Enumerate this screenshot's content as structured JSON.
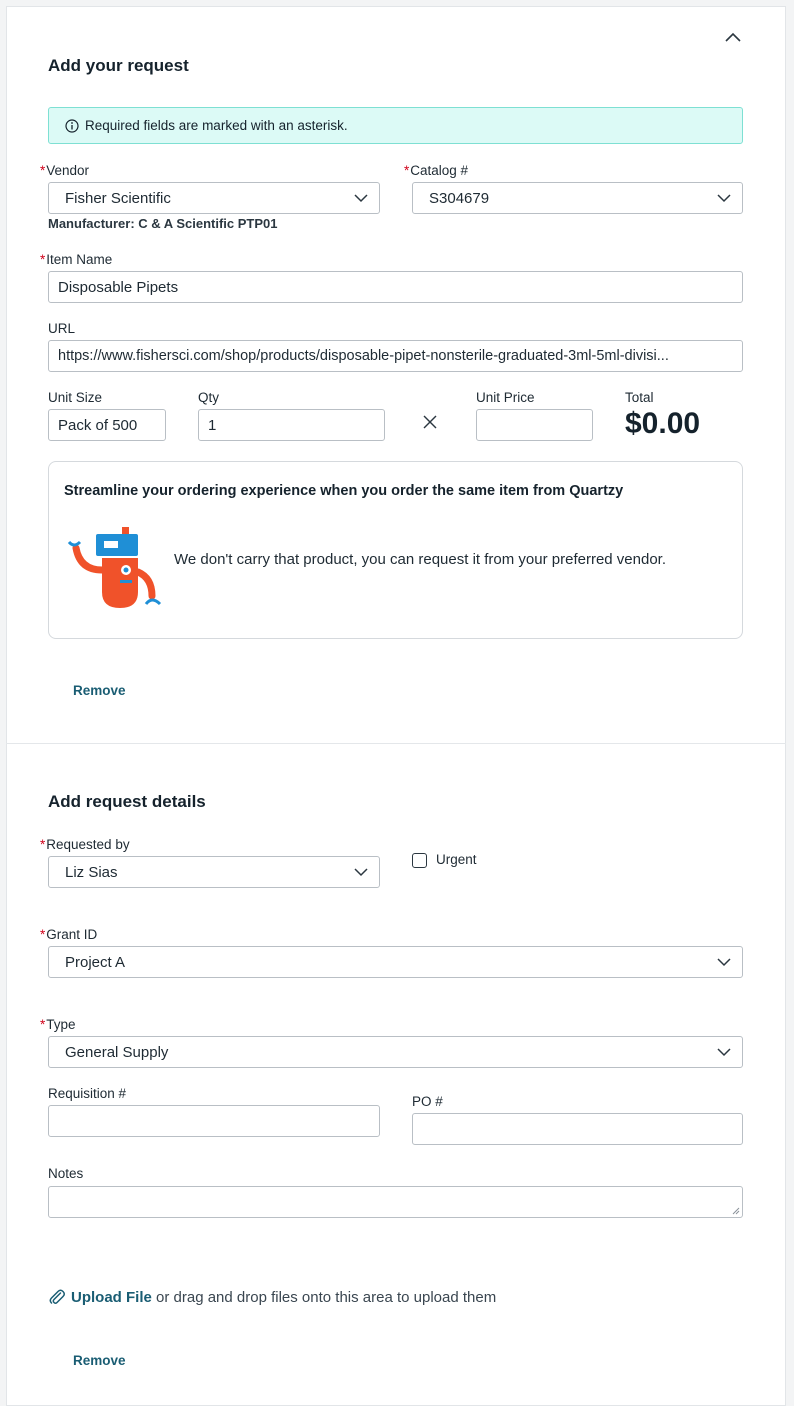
{
  "request": {
    "heading": "Add your request",
    "info_text": "Required fields are marked with an asterisk.",
    "required_marker": "*",
    "vendor": {
      "label": "Vendor",
      "value": "Fisher Scientific"
    },
    "manufacturer": "Manufacturer: C & A Scientific PTP01",
    "catalog": {
      "label": "Catalog #",
      "value": "S304679"
    },
    "item_name": {
      "label": "Item Name",
      "value": "Disposable Pipets"
    },
    "url": {
      "label": "URL",
      "value": "https://www.fishersci.com/shop/products/disposable-pipet-nonsterile-graduated-3ml-5ml-divisi..."
    },
    "unit_size": {
      "label": "Unit Size",
      "value": "Pack of 500"
    },
    "qty": {
      "label": "Qty",
      "value": "1"
    },
    "unit_price": {
      "label": "Unit Price",
      "value": ""
    },
    "total": {
      "label": "Total",
      "value": "$0.00"
    },
    "promo": {
      "title": "Streamline your ordering experience when you order the same item from Quartzy",
      "message": "We don't carry that product, you can request it from your preferred vendor."
    },
    "remove_label": "Remove"
  },
  "details": {
    "heading": "Add request details",
    "requested_by": {
      "label": "Requested by",
      "value": "Liz Sias"
    },
    "urgent_label": "Urgent",
    "urgent_checked": false,
    "grant_id": {
      "label": "Grant ID",
      "value": "Project A"
    },
    "type": {
      "label": "Type",
      "value": "General Supply"
    },
    "requisition": {
      "label": "Requisition #",
      "value": ""
    },
    "po": {
      "label": "PO #",
      "value": ""
    },
    "notes": {
      "label": "Notes",
      "value": ""
    },
    "upload": {
      "link_label": "Upload File",
      "hint": " or drag and drop files onto this area to upload them"
    },
    "remove_label": "Remove"
  },
  "colors": {
    "required": "#d0021b",
    "info_bg": "#dcfaf6",
    "info_border": "#7ee0d3",
    "link": "#1a5d73",
    "robot_orange": "#f0522a",
    "robot_blue": "#1f8fd6"
  },
  "icons": [
    "chevron-up-icon",
    "info-icon",
    "chevron-down-icon",
    "close-icon",
    "robot-illustration",
    "paperclip-icon"
  ]
}
